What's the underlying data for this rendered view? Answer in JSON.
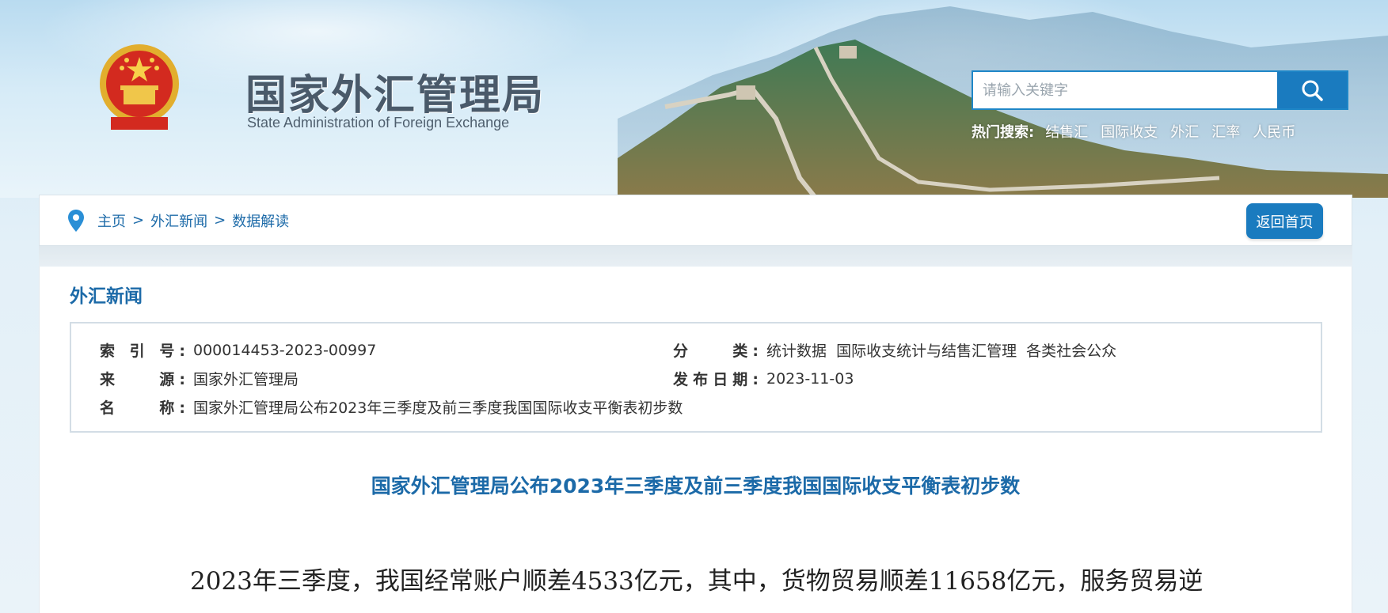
{
  "header": {
    "site_name_cn": "国家外汇管理局",
    "site_name_en": "State Administration of Foreign Exchange",
    "emblem_icon": "national-emblem-icon",
    "search": {
      "placeholder": "请输入关键字",
      "button_icon": "search-icon"
    },
    "hot_search": {
      "label": "热门搜索:",
      "items": [
        "结售汇",
        "国际收支",
        "外汇",
        "汇率",
        "人民币"
      ]
    }
  },
  "breadcrumb": {
    "icon": "location-pin-icon",
    "items": [
      "主页",
      "外汇新闻",
      "数据解读"
    ],
    "separator": ">",
    "back_home_label": "返回首页"
  },
  "section": {
    "title": "外汇新闻"
  },
  "meta": {
    "index_label": "索 引 号:",
    "index_value": "000014453-2023-00997",
    "category_label": "分　　类:",
    "category_value": "统计数据  国际收支统计与结售汇管理  各类社会公众",
    "source_label": "来　　源:",
    "source_value": "国家外汇管理局",
    "date_label": "发布日期:",
    "date_value": "2023-11-03",
    "name_label": "名　　称:",
    "name_value": "国家外汇管理局公布2023年三季度及前三季度我国国际收支平衡表初步数"
  },
  "article": {
    "title": "国家外汇管理局公布2023年三季度及前三季度我国国际收支平衡表初步数",
    "first_line": "2023年三季度，我国经常账户顺差4533亿元，其中，货物贸易顺差11658亿元，服务贸易逆"
  },
  "colors": {
    "primary_blue": "#1a7bbf",
    "link_blue": "#1c6aa8",
    "text": "#333333"
  }
}
